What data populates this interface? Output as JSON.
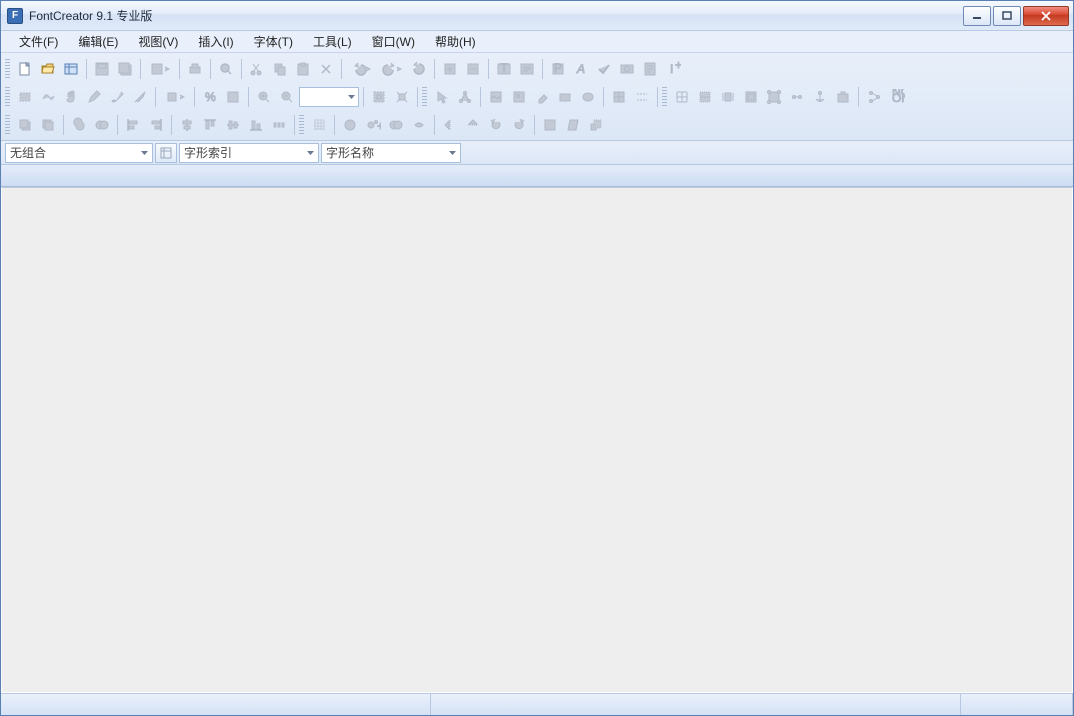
{
  "window": {
    "title": "FontCreator 9.1 专业版"
  },
  "menu": {
    "items": [
      {
        "label": "文件(F)"
      },
      {
        "label": "编辑(E)"
      },
      {
        "label": "视图(V)"
      },
      {
        "label": "插入(I)"
      },
      {
        "label": "字体(T)"
      },
      {
        "label": "工具(L)"
      },
      {
        "label": "窗口(W)"
      },
      {
        "label": "帮助(H)"
      }
    ]
  },
  "filter": {
    "combo1": "无组合",
    "combo2": "字形索引",
    "combo3": "字形名称"
  }
}
